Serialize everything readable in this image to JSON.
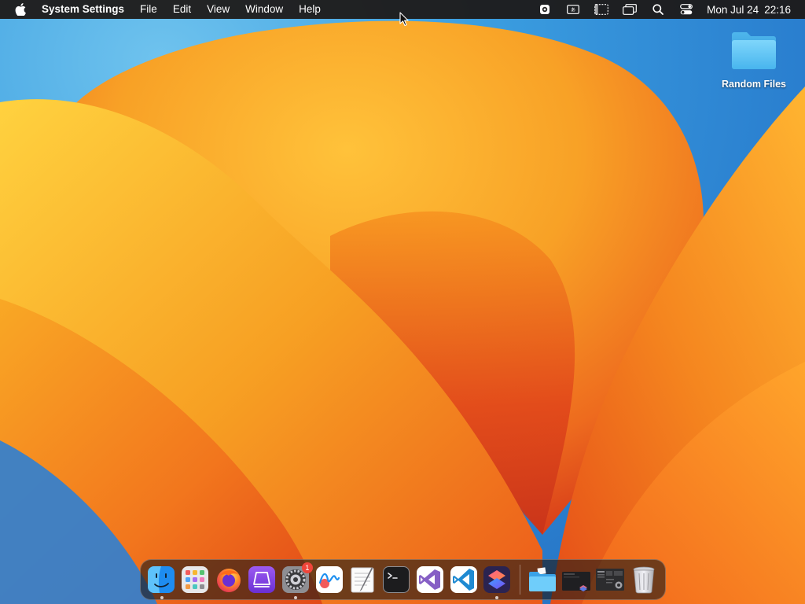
{
  "menubar": {
    "app_name": "System Settings",
    "menus": [
      "File",
      "Edit",
      "View",
      "Window",
      "Help"
    ],
    "status_icons": [
      "gear-icon",
      "keyboard-input-icon",
      "screen-mirror-icon",
      "windows-icon",
      "search-icon",
      "control-center-icon"
    ],
    "clock": {
      "date": "Mon Jul 24",
      "time": "22:16"
    }
  },
  "desktop": {
    "folder_label": "Random Files"
  },
  "dock": {
    "apps": [
      {
        "name": "Finder",
        "icon": "finder-icon",
        "running": true
      },
      {
        "name": "Launchpad",
        "icon": "launchpad-icon",
        "running": false
      },
      {
        "name": "Firefox",
        "icon": "firefox-icon",
        "running": false
      },
      {
        "name": "Stack",
        "icon": "stack-app-icon",
        "running": false
      },
      {
        "name": "System Settings",
        "icon": "system-settings-icon",
        "running": true,
        "badge": "1"
      },
      {
        "name": "Freeform",
        "icon": "freeform-icon",
        "running": false
      },
      {
        "name": "TextEdit",
        "icon": "textedit-icon",
        "running": false
      },
      {
        "name": "Terminal",
        "icon": "terminal-icon",
        "running": false
      },
      {
        "name": "Visual Studio",
        "icon": "visual-studio-icon",
        "running": false
      },
      {
        "name": "Visual Studio Code",
        "icon": "vscode-icon",
        "running": false
      },
      {
        "name": "Shortcuts",
        "icon": "shortcuts-icon",
        "running": true
      }
    ],
    "stacks": [
      {
        "name": "Folder",
        "icon": "folder-stack-icon"
      },
      {
        "name": "Screenshot",
        "icon": "screenshot-stack-icon"
      },
      {
        "name": "Screenshots",
        "icon": "screenshots-stack-icon"
      },
      {
        "name": "Trash",
        "icon": "trash-icon"
      }
    ]
  },
  "colors": {
    "accent_badge": "#f0453a",
    "folder_blue": "#5ac8fa",
    "wallpaper_orange": "#f7941d"
  }
}
